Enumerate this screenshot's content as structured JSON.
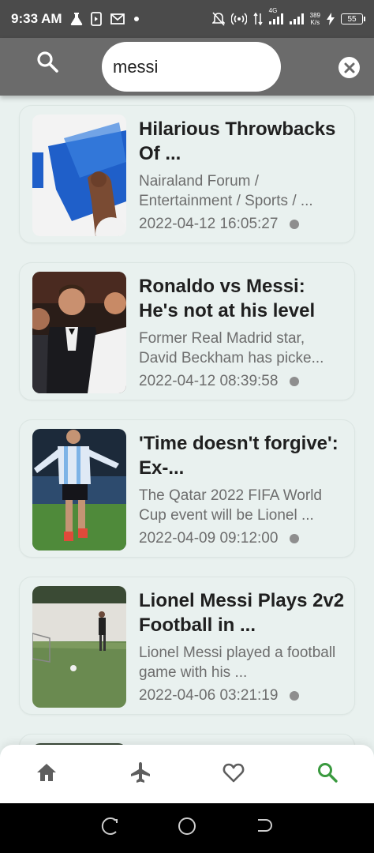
{
  "status_bar": {
    "time": "9:33 AM",
    "speed_value": "389",
    "speed_unit": "K/s",
    "network": "4G",
    "battery": "55",
    "left_icons": [
      "flask-icon",
      "media-icon",
      "gmail-icon",
      "dot-icon"
    ],
    "right_icons": [
      "bell-off-icon",
      "hotspot-icon",
      "data-arrows-icon",
      "signal-icon",
      "signal-icon",
      "charging-icon",
      "battery-icon"
    ]
  },
  "search": {
    "value": "messi",
    "placeholder": "",
    "icons": [
      "search-icon",
      "clear-icon"
    ]
  },
  "articles": [
    {
      "title": "Hilarious Throwbacks Of ...",
      "description": "Nairaland Forum / Entertainment / Sports / ...",
      "timestamp": "2022-04-12 16:05:27"
    },
    {
      "title": "Ronaldo vs Messi: He's not at his level",
      "description": "Former Real Madrid star, David Beckham has picke...",
      "timestamp": "2022-04-12 08:39:58"
    },
    {
      "title": "'Time doesn't forgive': Ex-...",
      "description": "The Qatar 2022 FIFA World Cup event will be Lionel ...",
      "timestamp": "2022-04-09 09:12:00"
    },
    {
      "title": "Lionel Messi Plays 2v2 Football in ...",
      "description": "Lionel Messi played a football game with his ...",
      "timestamp": "2022-04-06 03:21:19"
    }
  ],
  "bottom_nav": {
    "items": [
      "home-icon",
      "airplane-icon",
      "heart-icon",
      "search-icon"
    ],
    "active_color": "#3a9a3f",
    "inactive_color": "#5e5e5e"
  },
  "colors": {
    "status_bar": "#4b4b4b",
    "header": "#6b6b6b",
    "background": "#e9f1ef"
  }
}
